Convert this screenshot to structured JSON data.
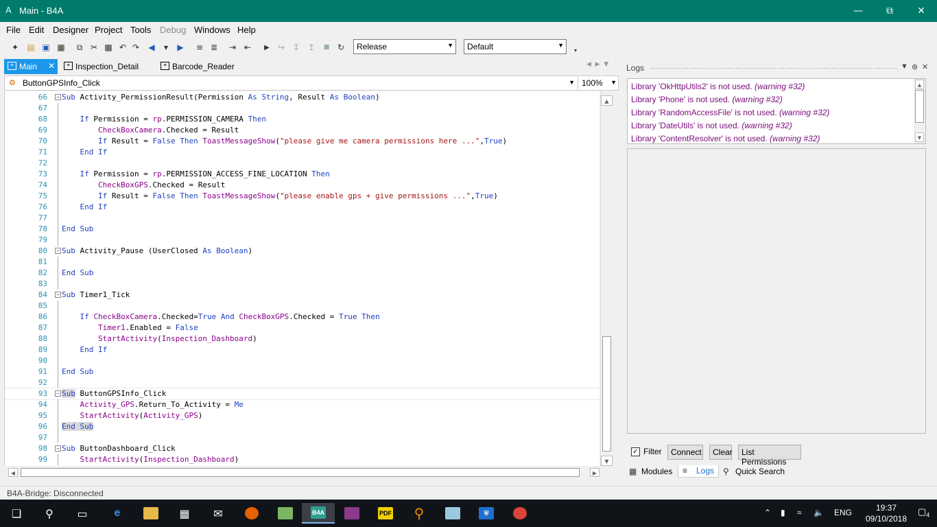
{
  "window": {
    "title": "Main - B4A",
    "app_icon": "A"
  },
  "menu": [
    "File",
    "Edit",
    "Designer",
    "Project",
    "Tools",
    "Debug",
    "Windows",
    "Help"
  ],
  "menu_disabled": "Debug",
  "toolbar": {
    "build_config": "Release",
    "device_config": "Default"
  },
  "tabs": [
    {
      "label": "Main",
      "active": true
    },
    {
      "label": "Inspection_Detail",
      "active": false
    },
    {
      "label": "Barcode_Reader",
      "active": false
    }
  ],
  "sub_selector": "ButtonGPSInfo_Click",
  "zoom": "100%",
  "code_lines": [
    {
      "n": "66",
      "t": "Sub Activity_PermissionResult(Permission As String, Result As Boolean)"
    },
    {
      "n": "67",
      "t": ""
    },
    {
      "n": "68",
      "t": "    If Permission = rp.PERMISSION_CAMERA Then"
    },
    {
      "n": "69",
      "t": "        CheckBoxCamera.Checked = Result"
    },
    {
      "n": "70",
      "t": "        If Result = False Then ToastMessageShow(\"please give me camera permissions here ...\",True)"
    },
    {
      "n": "71",
      "t": "    End If"
    },
    {
      "n": "72",
      "t": ""
    },
    {
      "n": "73",
      "t": "    If Permission = rp.PERMISSION_ACCESS_FINE_LOCATION Then"
    },
    {
      "n": "74",
      "t": "        CheckBoxGPS.Checked = Result"
    },
    {
      "n": "75",
      "t": "        If Result = False Then ToastMessageShow(\"please enable gps + give permissions ...\",True)"
    },
    {
      "n": "76",
      "t": "    End If"
    },
    {
      "n": "77",
      "t": ""
    },
    {
      "n": "78",
      "t": "End Sub"
    },
    {
      "n": "79",
      "t": ""
    },
    {
      "n": "80",
      "t": "Sub Activity_Pause (UserClosed As Boolean)"
    },
    {
      "n": "81",
      "t": ""
    },
    {
      "n": "82",
      "t": "End Sub"
    },
    {
      "n": "83",
      "t": ""
    },
    {
      "n": "84",
      "t": "Sub Timer1_Tick"
    },
    {
      "n": "85",
      "t": ""
    },
    {
      "n": "86",
      "t": "    If CheckBoxCamera.Checked=True And CheckBoxGPS.Checked = True Then"
    },
    {
      "n": "87",
      "t": "        Timer1.Enabled = False"
    },
    {
      "n": "88",
      "t": "        StartActivity(Inspection_Dashboard)"
    },
    {
      "n": "89",
      "t": "    End If"
    },
    {
      "n": "90",
      "t": ""
    },
    {
      "n": "91",
      "t": "End Sub"
    },
    {
      "n": "92",
      "t": ""
    },
    {
      "n": "93",
      "t": "Sub ButtonGPSInfo_Click"
    },
    {
      "n": "94",
      "t": "    Activity_GPS.Return_To_Activity = Me"
    },
    {
      "n": "95",
      "t": "    StartActivity(Activity_GPS)"
    },
    {
      "n": "96",
      "t": "End Sub"
    },
    {
      "n": "97",
      "t": ""
    },
    {
      "n": "98",
      "t": "Sub ButtonDashboard_Click"
    },
    {
      "n": "99",
      "t": "    StartActivity(Inspection_Dashboard)"
    }
  ],
  "logs": {
    "title": "Logs",
    "entries": [
      {
        "text": "Library 'OkHttpUtils2' is not used.",
        "warning": "(warning #32)"
      },
      {
        "text": "Library 'Phone' is not used.",
        "warning": "(warning #32)"
      },
      {
        "text": "Library 'RandomAccessFile' is not used.",
        "warning": "(warning #32)"
      },
      {
        "text": "Library 'DateUtils' is not used.",
        "warning": "(warning #32)"
      },
      {
        "text": "Library 'ContentResolver' is not used.",
        "warning": "(warning #32)"
      }
    ],
    "filter_label": "Filter",
    "filter_checked": true,
    "connect": "Connect",
    "clear": "Clear",
    "list_permissions": "List Permissions"
  },
  "bottom_tabs": [
    "Modules",
    "Logs",
    "Quick Search"
  ],
  "status": "B4A-Bridge: Disconnected",
  "taskbar": {
    "language": "ENG",
    "time": "19:37",
    "date": "09/10/2018",
    "notifications": "4",
    "b4a_label": "B4A"
  }
}
